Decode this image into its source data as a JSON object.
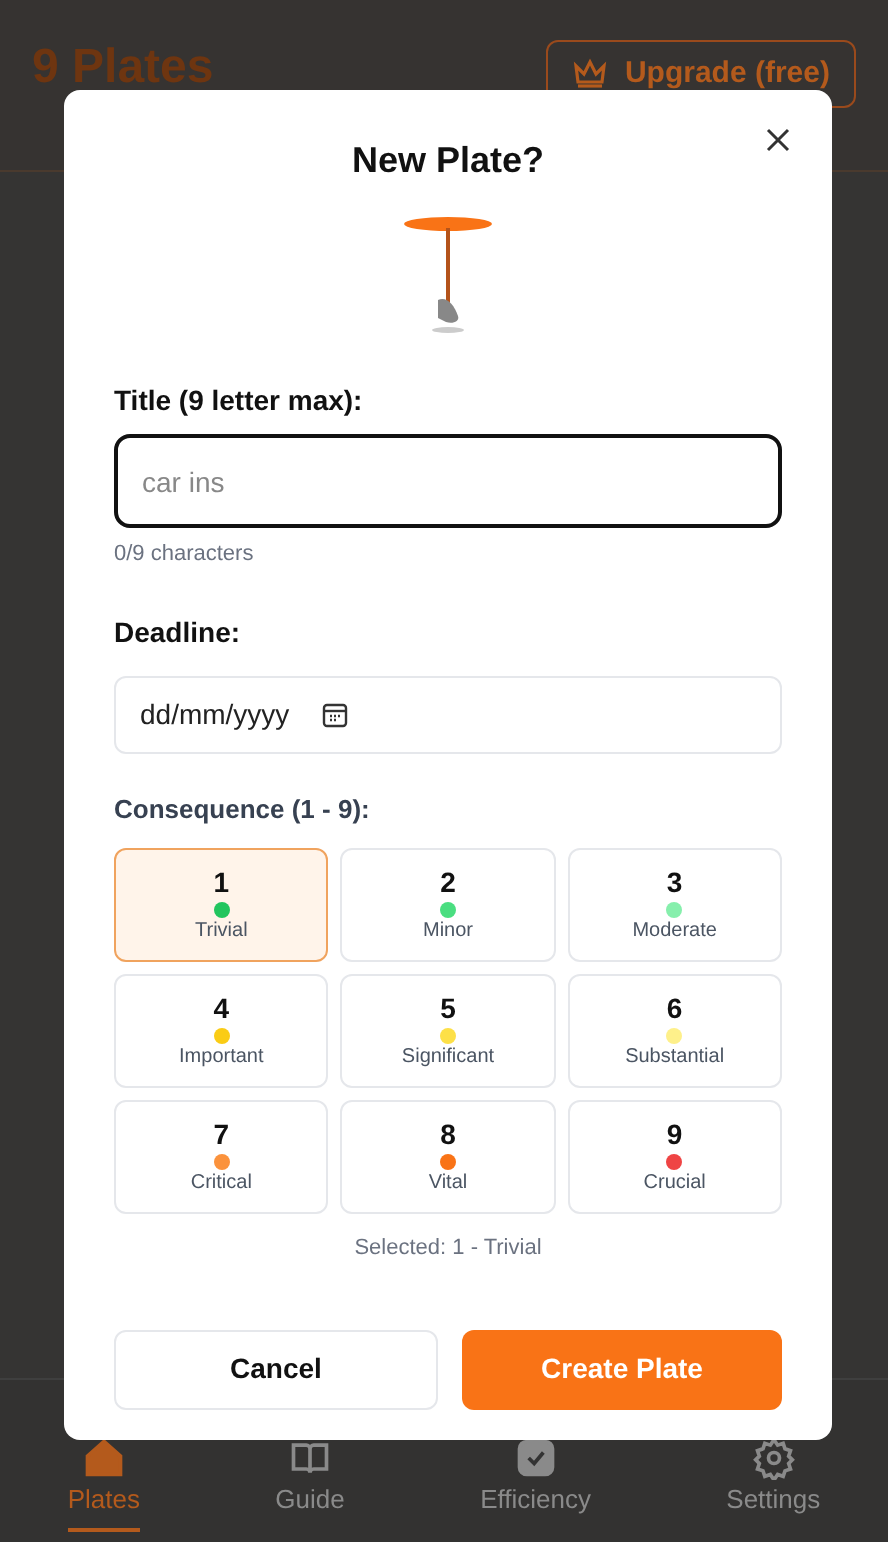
{
  "app": {
    "title": "9 Plates",
    "upgrade_button": "Upgrade (free)"
  },
  "nav": [
    {
      "label": "Plates",
      "kind": "plates",
      "selected": true
    },
    {
      "label": "Guide",
      "kind": "guide",
      "selected": false
    },
    {
      "label": "Efficiency",
      "kind": "efficiency",
      "selected": false
    },
    {
      "label": "Settings",
      "kind": "settings",
      "selected": false
    }
  ],
  "dialog": {
    "title": "New Plate?",
    "title_field": {
      "label": "Title (9 letter max):",
      "placeholder": "car ins",
      "counter": "0/9 characters"
    },
    "deadline_field": {
      "label": "Deadline:",
      "placeholder": "dd/mm/yyyy"
    },
    "consequence": {
      "label": "Consequence (1 - 9):",
      "options": [
        {
          "number": "1",
          "label": "Trivial",
          "color": "#22c55e",
          "selected": true
        },
        {
          "number": "2",
          "label": "Minor",
          "color": "#4ade80",
          "selected": false
        },
        {
          "number": "3",
          "label": "Moderate",
          "color": "#86efac",
          "selected": false
        },
        {
          "number": "4",
          "label": "Important",
          "color": "#facc15",
          "selected": false
        },
        {
          "number": "5",
          "label": "Significant",
          "color": "#fde047",
          "selected": false
        },
        {
          "number": "6",
          "label": "Substantial",
          "color": "#fef08a",
          "selected": false
        },
        {
          "number": "7",
          "label": "Critical",
          "color": "#fb923c",
          "selected": false
        },
        {
          "number": "8",
          "label": "Vital",
          "color": "#f97316",
          "selected": false
        },
        {
          "number": "9",
          "label": "Crucial",
          "color": "#ef4444",
          "selected": false
        }
      ],
      "summary": "Selected: 1 - Trivial"
    },
    "buttons": {
      "cancel": "Cancel",
      "create": "Create Plate"
    }
  }
}
